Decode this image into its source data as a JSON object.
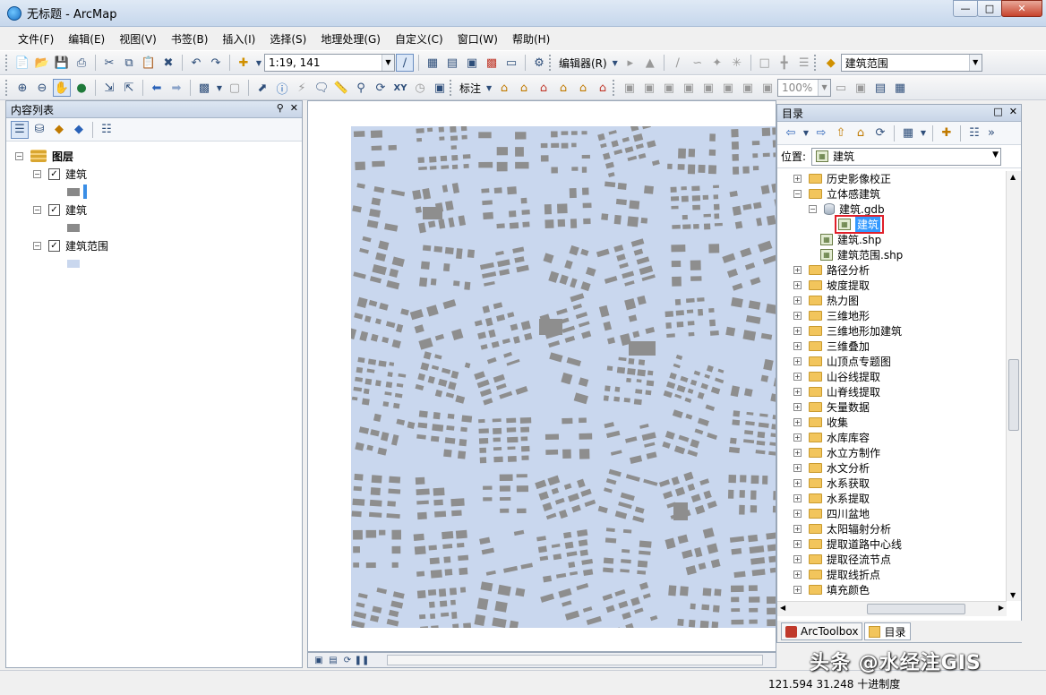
{
  "window": {
    "title": "无标题 - ArcMap"
  },
  "menu": [
    "文件(F)",
    "编辑(E)",
    "视图(V)",
    "书签(B)",
    "插入(I)",
    "选择(S)",
    "地理处理(G)",
    "自定义(C)",
    "窗口(W)",
    "帮助(H)"
  ],
  "toolbar": {
    "scale": "1:19, 141",
    "editor_label": "编辑器(R)",
    "target_layer": "建筑范围",
    "label_menu": "标注",
    "zoom": "100%"
  },
  "toc": {
    "title": "内容列表",
    "root": "图层",
    "layers": [
      {
        "name": "建筑",
        "swatch_color": "#888888",
        "accent_color": "#3a8ee6"
      },
      {
        "name": "建筑",
        "swatch_color": "#8a8a8a"
      },
      {
        "name": "建筑范围",
        "swatch_color": "#c9d7ee"
      }
    ]
  },
  "map": {
    "background_color": "#c9d7ee",
    "building_color": "#8e8e8e"
  },
  "catalog": {
    "title": "目录",
    "location_label": "位置:",
    "location_value": "建筑",
    "tree": {
      "before": [
        "历史影像校正"
      ],
      "open_folder": "立体感建筑",
      "gdb": "建筑.gdb",
      "selected_fc": "建筑",
      "shp_files": [
        "建筑.shp",
        "建筑范围.shp"
      ],
      "after": [
        "路径分析",
        "坡度提取",
        "热力图",
        "三维地形",
        "三维地形加建筑",
        "三维叠加",
        "山顶点专题图",
        "山谷线提取",
        "山脊线提取",
        "矢量数据",
        "收集",
        "水库库容",
        "水立方制作",
        "水文分析",
        "水系获取",
        "水系提取",
        "四川盆地",
        "太阳辐射分析",
        "提取道路中心线",
        "提取径流节点",
        "提取线折点",
        "填充颜色"
      ]
    },
    "tabs": [
      "ArcToolbox",
      "目录"
    ]
  },
  "status": {
    "coords": "121.594  31.248 十进制度"
  },
  "watermark": "头条 @水经注GIS"
}
